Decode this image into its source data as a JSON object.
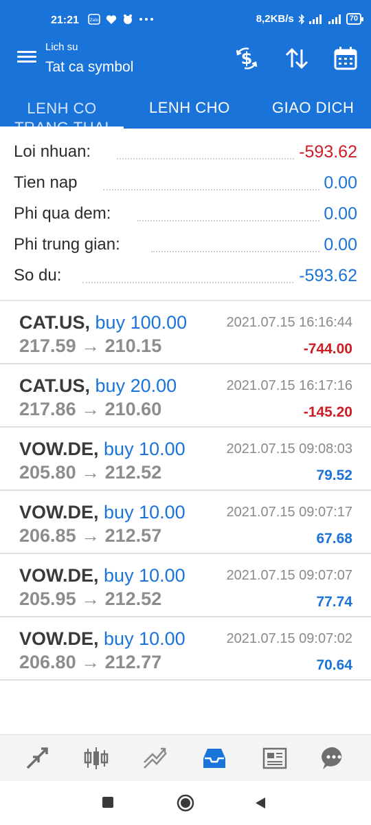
{
  "status_bar": {
    "time": "21:21",
    "network_speed": "8,2KB/s",
    "battery": "70",
    "notification_icons": [
      "zalo-icon",
      "heart-icon",
      "app-icon",
      "more-dots-icon"
    ]
  },
  "toolbar": {
    "subtitle": "Lich su",
    "title": "Tat ca symbol",
    "actions": [
      "currency-icon",
      "sort-icon",
      "calendar-icon"
    ]
  },
  "tabs": [
    {
      "label": "LENH CO TRANG THAI",
      "active": true
    },
    {
      "label": "LENH CHO",
      "active": false
    },
    {
      "label": "GIAO DICH",
      "active": false
    }
  ],
  "summary": [
    {
      "label": "Loi nhuan:",
      "value": "-593.62",
      "negative": true
    },
    {
      "label": "Tien nap",
      "value": "0.00",
      "negative": false
    },
    {
      "label": "Phi qua dem:",
      "value": "0.00",
      "negative": false
    },
    {
      "label": "Phi trung gian:",
      "value": "0.00",
      "negative": false
    },
    {
      "label": "So du:",
      "value": "-593.62",
      "negative": false
    }
  ],
  "trades": [
    {
      "symbol": "CAT.US,",
      "side": "buy 100.00",
      "time": "2021.07.15 16:16:44",
      "open": "217.59",
      "close": "210.15",
      "profit": "-744.00",
      "negative": true
    },
    {
      "symbol": "CAT.US,",
      "side": "buy 20.00",
      "time": "2021.07.15 16:17:16",
      "open": "217.86",
      "close": "210.60",
      "profit": "-145.20",
      "negative": true
    },
    {
      "symbol": "VOW.DE,",
      "side": "buy 10.00",
      "time": "2021.07.15 09:08:03",
      "open": "205.80",
      "close": "212.52",
      "profit": "79.52",
      "negative": false
    },
    {
      "symbol": "VOW.DE,",
      "side": "buy 10.00",
      "time": "2021.07.15 09:07:17",
      "open": "206.85",
      "close": "212.57",
      "profit": "67.68",
      "negative": false
    },
    {
      "symbol": "VOW.DE,",
      "side": "buy 10.00",
      "time": "2021.07.15 09:07:07",
      "open": "205.95",
      "close": "212.52",
      "profit": "77.74",
      "negative": false
    },
    {
      "symbol": "VOW.DE,",
      "side": "buy 10.00",
      "time": "2021.07.15 09:07:02",
      "open": "206.80",
      "close": "212.77",
      "profit": "70.64",
      "negative": false
    }
  ],
  "price_arrow": "→",
  "bottom_nav": [
    "quotes-icon",
    "chart-icon",
    "trade-icon",
    "history-icon",
    "news-icon",
    "chat-icon"
  ],
  "colors": {
    "primary": "#1a73d9",
    "negative": "#cc1c24",
    "positive": "#1a73d9",
    "active_nav": "#1a73d9"
  }
}
